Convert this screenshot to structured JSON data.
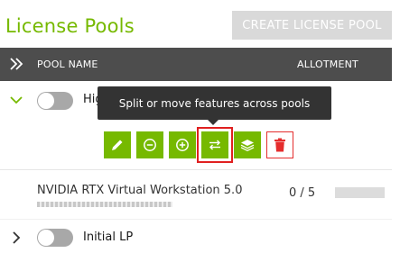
{
  "page": {
    "title": "License Pools",
    "create_button": "CREATE LICENSE POOL"
  },
  "table": {
    "col_name": "POOL NAME",
    "col_allotment": "ALLOTMENT"
  },
  "pools": [
    {
      "name": "HighPerformanceUsers",
      "visible_name": "High",
      "expanded": true,
      "enabled": false
    },
    {
      "name": "Initial LP",
      "expanded": false,
      "enabled": false
    }
  ],
  "license": {
    "name": "NVIDIA RTX Virtual Workstation 5.0",
    "count": "0 / 5"
  },
  "tooltip": "Split or move features across pools",
  "actions": [
    "edit-icon",
    "minus-circle-icon",
    "plus-circle-icon",
    "split-arrows-icon",
    "layers-icon",
    "trash-icon"
  ],
  "colors": {
    "accent": "#76b900",
    "header": "#4d4d4d",
    "danger": "#e52d2d",
    "disabled": "#d9d9d9"
  }
}
